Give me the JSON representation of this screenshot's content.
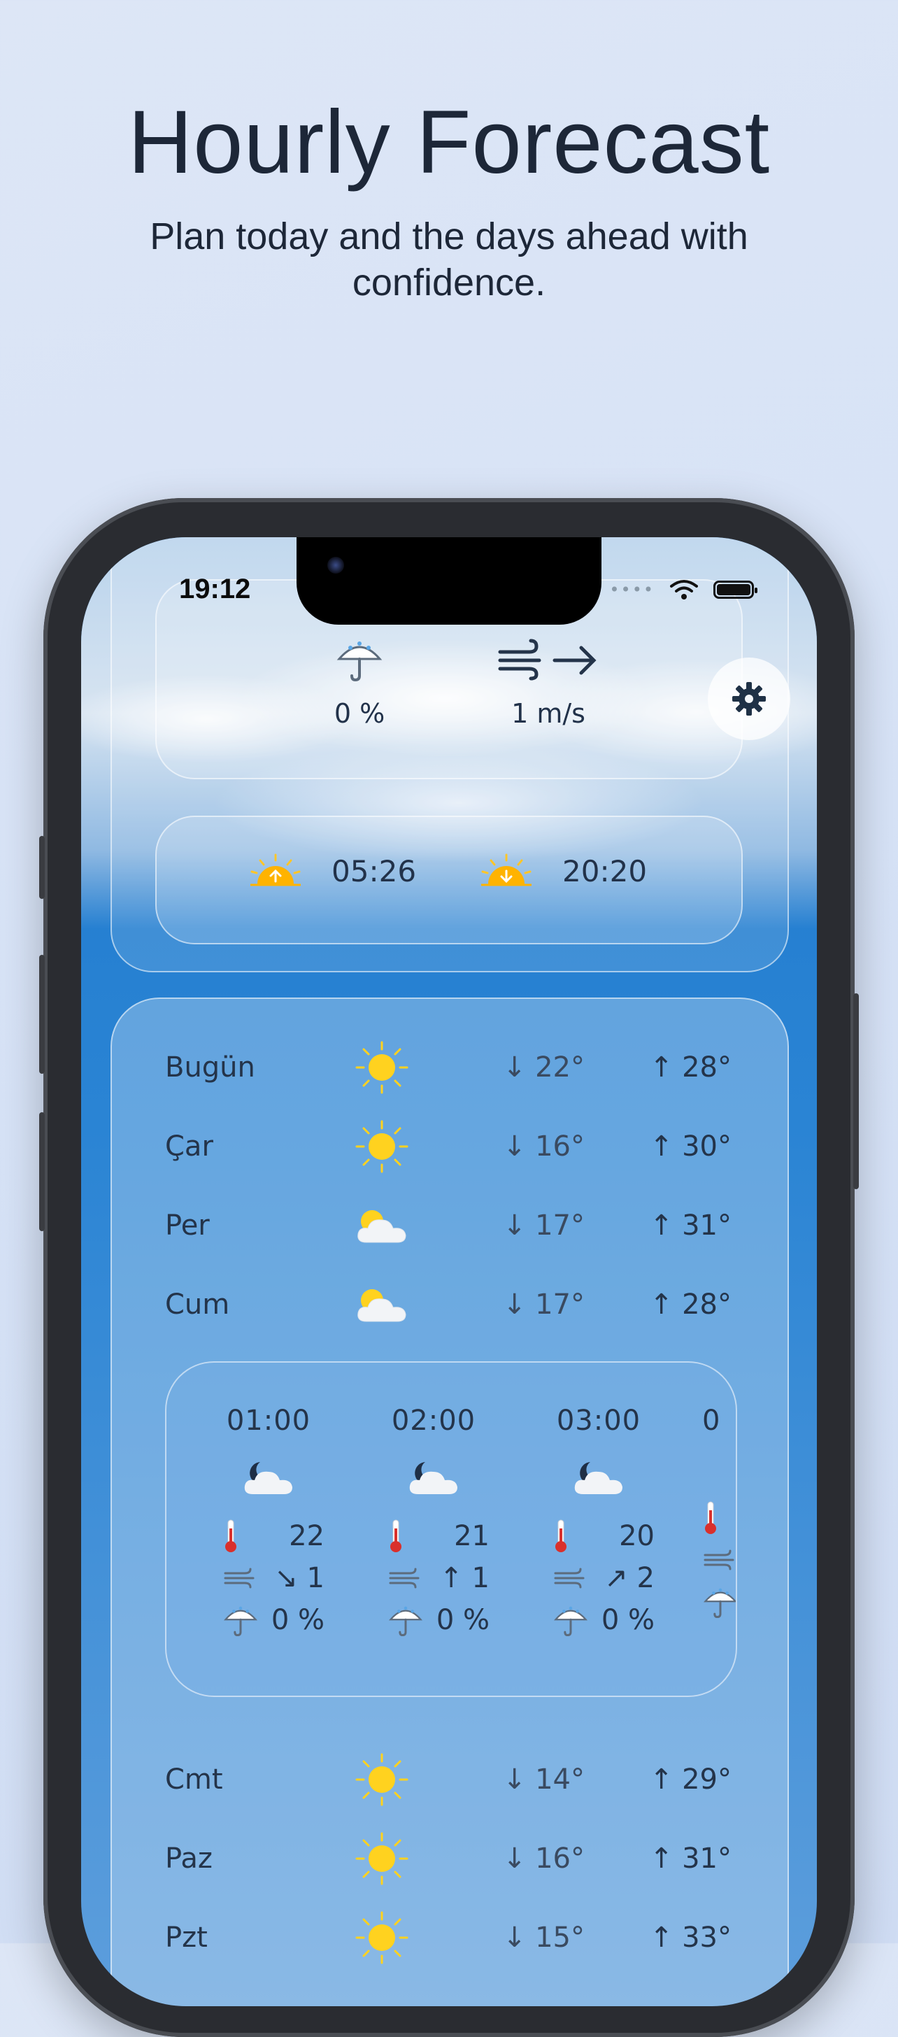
{
  "hero": {
    "title": "Hourly Forecast",
    "subtitle": "Plan today and the days ahead with confidence."
  },
  "status_bar": {
    "time": "19:12",
    "signal": "••••"
  },
  "current": {
    "precipitation": "0 %",
    "wind": "1 m/s",
    "sunrise": "05:26",
    "sunset": "20:20"
  },
  "days": [
    {
      "name": "Bugün",
      "icon": "sun-icon",
      "min": "↓ 22°",
      "max": "↑ 28°"
    },
    {
      "name": "Çar",
      "icon": "sun-icon",
      "min": "↓ 16°",
      "max": "↑ 30°"
    },
    {
      "name": "Per",
      "icon": "partly-cloudy-icon",
      "min": "↓ 17°",
      "max": "↑ 31°"
    },
    {
      "name": "Cum",
      "icon": "partly-cloudy-icon",
      "min": "↓ 17°",
      "max": "↑ 28°"
    }
  ],
  "hourly": [
    {
      "time": "01:00",
      "temp": "22",
      "wind_dir": "↘",
      "wind": "1",
      "precip": "0 %"
    },
    {
      "time": "02:00",
      "temp": "21",
      "wind_dir": "↑",
      "wind": "1",
      "precip": "0 %"
    },
    {
      "time": "03:00",
      "temp": "20",
      "wind_dir": "↗",
      "wind": "2",
      "precip": "0 %"
    },
    {
      "time": "0"
    }
  ],
  "days_after": [
    {
      "name": "Cmt",
      "icon": "sun-icon",
      "min": "↓ 14°",
      "max": "↑ 29°"
    },
    {
      "name": "Paz",
      "icon": "sun-icon",
      "min": "↓ 16°",
      "max": "↑ 31°"
    },
    {
      "name": "Pzt",
      "icon": "sun-icon",
      "min": "↓ 15°",
      "max": "↑ 33°"
    }
  ],
  "colors": {
    "sun": "#ffd21f",
    "accent": "#1e78cc",
    "text": "#24344a"
  }
}
